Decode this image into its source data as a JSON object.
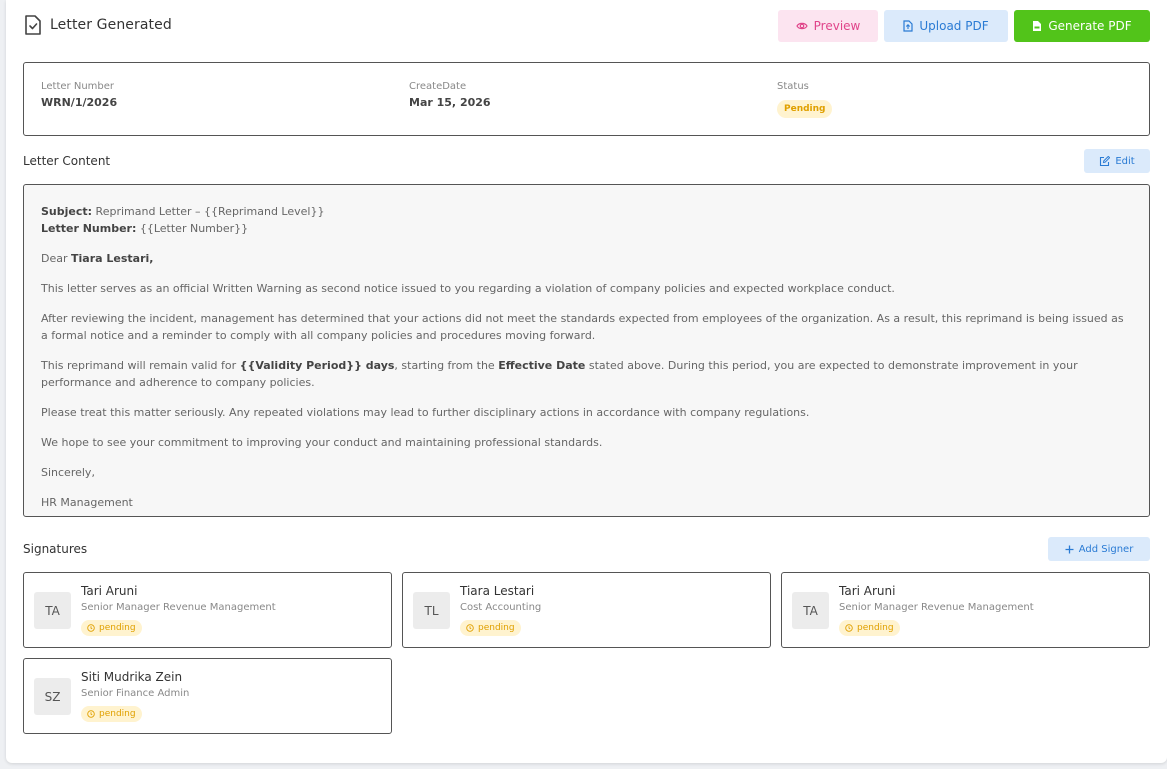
{
  "header": {
    "title": "Letter Generated",
    "preview_label": "Preview",
    "upload_label": "Upload PDF",
    "generate_label": "Generate PDF"
  },
  "info": {
    "letter_number_label": "Letter Number",
    "letter_number": "WRN/1/2026",
    "create_date_label": "CreateDate",
    "create_date": "Mar 15, 2026",
    "status_label": "Status",
    "status": "Pending"
  },
  "content": {
    "section_title": "Letter Content",
    "edit_label": "Edit",
    "subject_label": "Subject:",
    "subject_value": " Reprimand Letter – {{Reprimand Level}}",
    "letter_number_label": "Letter Number:",
    "letter_number_value": " {{Letter Number}}",
    "dear": "Dear ",
    "recipient": "Tiara Lestari,",
    "p1": "This letter serves as an official Written Warning as second notice issued to you regarding a violation of company policies and expected workplace conduct.",
    "p2": "After reviewing the incident, management has determined that your actions did not meet the standards expected from employees of the organization. As a result, this reprimand is being issued as a formal notice and a reminder to comply with all company policies and procedures moving forward.",
    "p3_a": "This reprimand will remain valid for ",
    "p3_b": "{{Validity Period}} days",
    "p3_c": ", starting from the ",
    "p3_d": "Effective Date",
    "p3_e": " stated above. During this period, you are expected to demonstrate improvement in your performance and adherence to company policies.",
    "p4": "Please treat this matter seriously. Any repeated violations may lead to further disciplinary actions in accordance with company regulations.",
    "p5": "We hope to see your commitment to improving your conduct and maintaining professional standards.",
    "closing": "Sincerely,",
    "sender": "HR Management"
  },
  "signatures": {
    "section_title": "Signatures",
    "add_label": "Add Signer",
    "signers": [
      {
        "initials": "TA",
        "name": "Tari Aruni",
        "role": "Senior Manager Revenue Management",
        "status": "pending"
      },
      {
        "initials": "TL",
        "name": "Tiara Lestari",
        "role": "Cost Accounting",
        "status": "pending"
      },
      {
        "initials": "TA",
        "name": "Tari Aruni",
        "role": "Senior Manager Revenue Management",
        "status": "pending"
      },
      {
        "initials": "SZ",
        "name": "Siti Mudrika Zein",
        "role": "Senior Finance Admin",
        "status": "pending"
      }
    ]
  },
  "colors": {
    "preview": "#e0448a",
    "upload": "#2a7bd4",
    "generate": "#52c41a",
    "pending": "#e0a000"
  }
}
